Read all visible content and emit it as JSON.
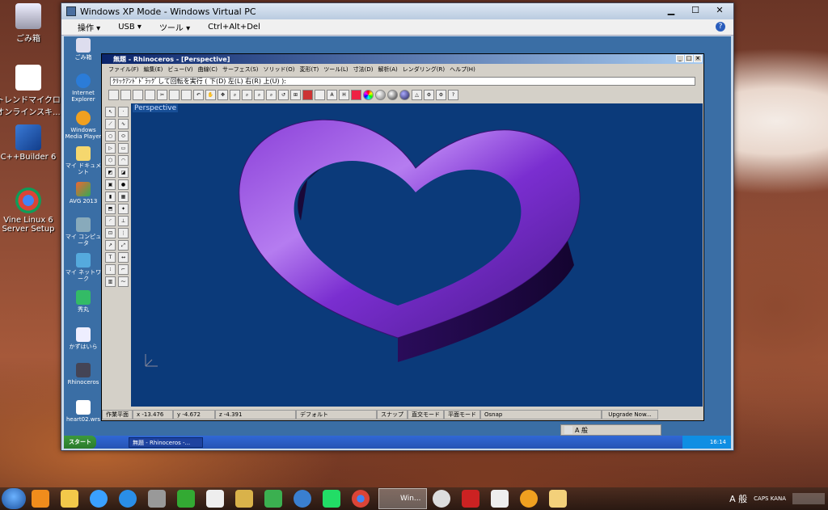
{
  "host": {
    "desktop_icons": [
      {
        "label": "ごみ箱"
      },
      {
        "label": "トレンドマイクロ オンラインスキ..."
      },
      {
        "label": "C++Builder 6"
      },
      {
        "label": "Vine Linux 6 Server Setup"
      }
    ],
    "taskbar": {
      "vpc_task_label": "Win..."
    },
    "tray": {
      "ime": "A 般",
      "caps": "CAPS KANA"
    }
  },
  "vpc": {
    "title": "Windows XP Mode - Windows Virtual PC",
    "menu": [
      "操作 ▾",
      "USB ▾",
      "ツール ▾",
      "Ctrl+Alt+Del"
    ],
    "guest": {
      "desktop_icons": [
        {
          "label": "ごみ箱"
        },
        {
          "label": "Internet Explorer"
        },
        {
          "label": "Windows Media Player"
        },
        {
          "label": "マイ ドキュメント"
        },
        {
          "label": "AVG 2013"
        },
        {
          "label": "マイ コンピュータ"
        },
        {
          "label": "マイ ネットワーク"
        },
        {
          "label": "秀丸"
        },
        {
          "label": "かずはいら"
        },
        {
          "label": "Rhinoceros"
        },
        {
          "label": "heart02.wrs"
        }
      ],
      "taskbar": {
        "start": "スタート",
        "task": "無題 - Rhinoceros -...",
        "clock": "16:14"
      },
      "lang_bar": "A 般"
    }
  },
  "rhino": {
    "title": "無題 - Rhinoceros - [Perspective]",
    "menu": [
      "ファイル(F)",
      "編集(E)",
      "ビュー(V)",
      "曲線(C)",
      "サーフェス(S)",
      "ソリッド(O)",
      "変形(T)",
      "ツール(L)",
      "寸法(D)",
      "解析(A)",
      "レンダリング(R)",
      "ヘルプ(H)"
    ],
    "command_prompt": "ｸﾘｯｸｱﾝﾄﾞﾄﾞﾗｯｸﾞして回転を実行 ( 下(D) 左(L) 右(R) 上(U) ):",
    "viewport_label": "Perspective",
    "status": {
      "cplane": "作業平面",
      "x": "x -13.476",
      "y": "y -4.672",
      "z": "z -4.391",
      "layer": "デフォルト",
      "snap": "スナップ",
      "ortho": "直交モード",
      "planar": "平面モード",
      "osnap": "Osnap",
      "upgrade": "Upgrade Now..."
    }
  }
}
